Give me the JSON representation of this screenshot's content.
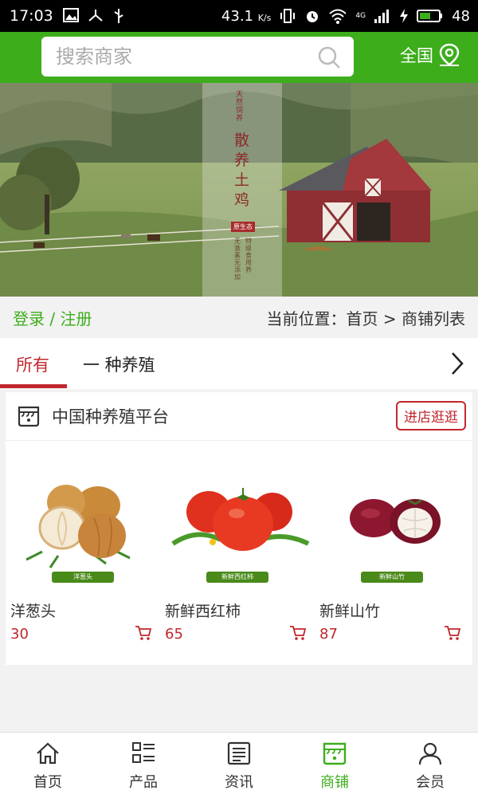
{
  "status_bar": {
    "time": "17:03",
    "speed": "43.1",
    "speed_unit": "K/s",
    "network": "4G",
    "battery": "48"
  },
  "search": {
    "placeholder": "搜索商家"
  },
  "region": {
    "label": "全国"
  },
  "banner": {
    "vertical_title": "散养土鸡",
    "vertical_tag": "天然饲养",
    "badge": "原生态",
    "side_text_1": "特级食用养",
    "side_text_2": "无激素无添加"
  },
  "breadcrumb": {
    "login": "登录 / 注册",
    "location": "当前位置：首页 > 商铺列表"
  },
  "tabs": [
    {
      "label": "所有",
      "active": true
    },
    {
      "label": "一 种养殖",
      "active": false
    }
  ],
  "shop": {
    "name": "中国种养殖平台",
    "enter_label": "进店逛逛"
  },
  "products": [
    {
      "name": "洋葱头",
      "price": "30",
      "tag": "洋葱头"
    },
    {
      "name": "新鲜西红柿",
      "price": "65",
      "tag": "新鲜西红柿"
    },
    {
      "name": "新鲜山竹",
      "price": "87",
      "tag": "新鲜山竹"
    }
  ],
  "nav": [
    {
      "label": "首页",
      "icon": "home-icon"
    },
    {
      "label": "产品",
      "icon": "list-icon"
    },
    {
      "label": "资讯",
      "icon": "news-icon"
    },
    {
      "label": "商铺",
      "icon": "store-icon",
      "active": true
    },
    {
      "label": "会员",
      "icon": "user-icon"
    }
  ],
  "colors": {
    "primary": "#3dad1c",
    "accent": "#c0272d"
  }
}
